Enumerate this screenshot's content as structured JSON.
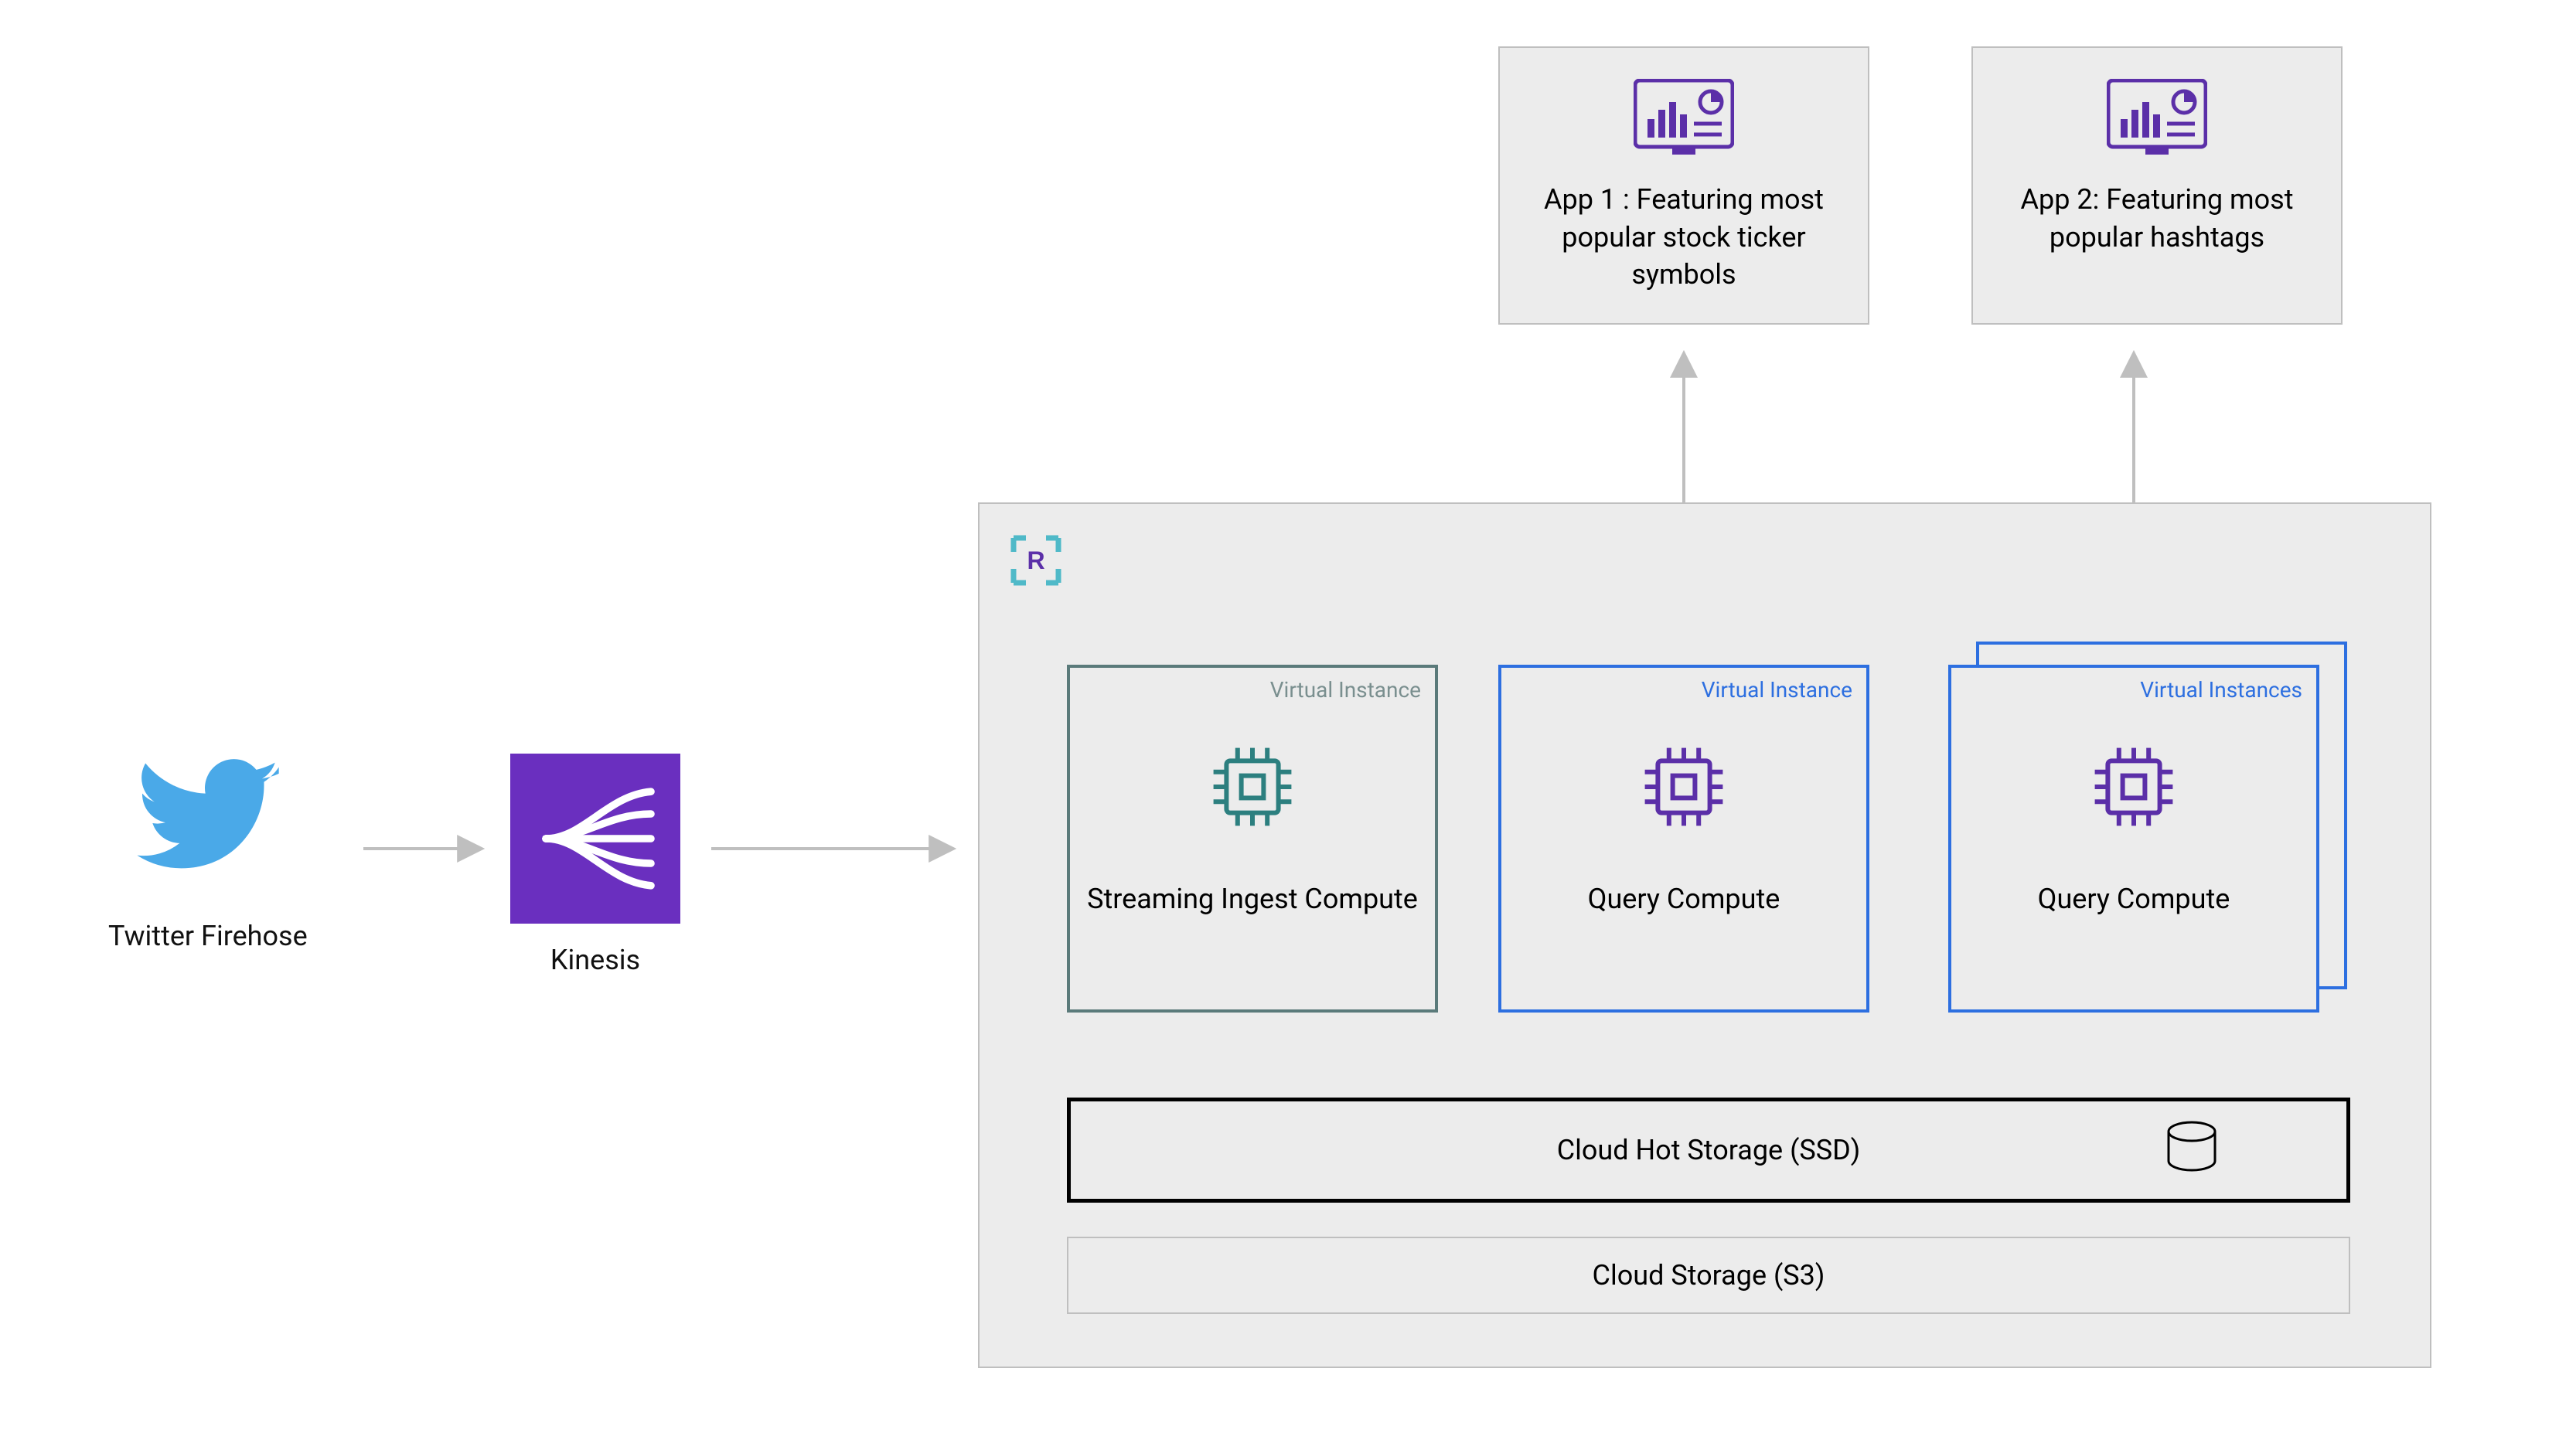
{
  "sources": {
    "twitter_label": "Twitter Firehose",
    "kinesis_label": "Kinesis"
  },
  "apps": {
    "app1": "App 1 : Featuring most popular stock ticker symbols",
    "app2": "App 2: Featuring most popular hashtags"
  },
  "platform": {
    "ingest": {
      "badge": "Virtual Instance",
      "title": "Streaming Ingest Compute"
    },
    "query1": {
      "badge": "Virtual Instance",
      "title": "Query Compute"
    },
    "query2": {
      "badge": "Virtual Instances",
      "title": "Query Compute"
    },
    "storage_hot": "Cloud Hot Storage (SSD)",
    "storage_cold": "Cloud Storage (S3)"
  },
  "icons": {
    "twitter": "twitter-icon",
    "kinesis": "kinesis-icon",
    "dashboard": "dashboard-icon",
    "chip_teal": "cpu-chip-icon",
    "chip_purple": "cpu-chip-icon",
    "disk": "disk-icon",
    "platform_logo": "rockset-icon"
  },
  "colors": {
    "teal": "#2c7f7f",
    "blue": "#2d6fe0",
    "purple": "#5b2fa8",
    "kinesis_bg": "#6a2fbf",
    "light_grey": "#ececec",
    "border_grey": "#bfbfbf"
  }
}
